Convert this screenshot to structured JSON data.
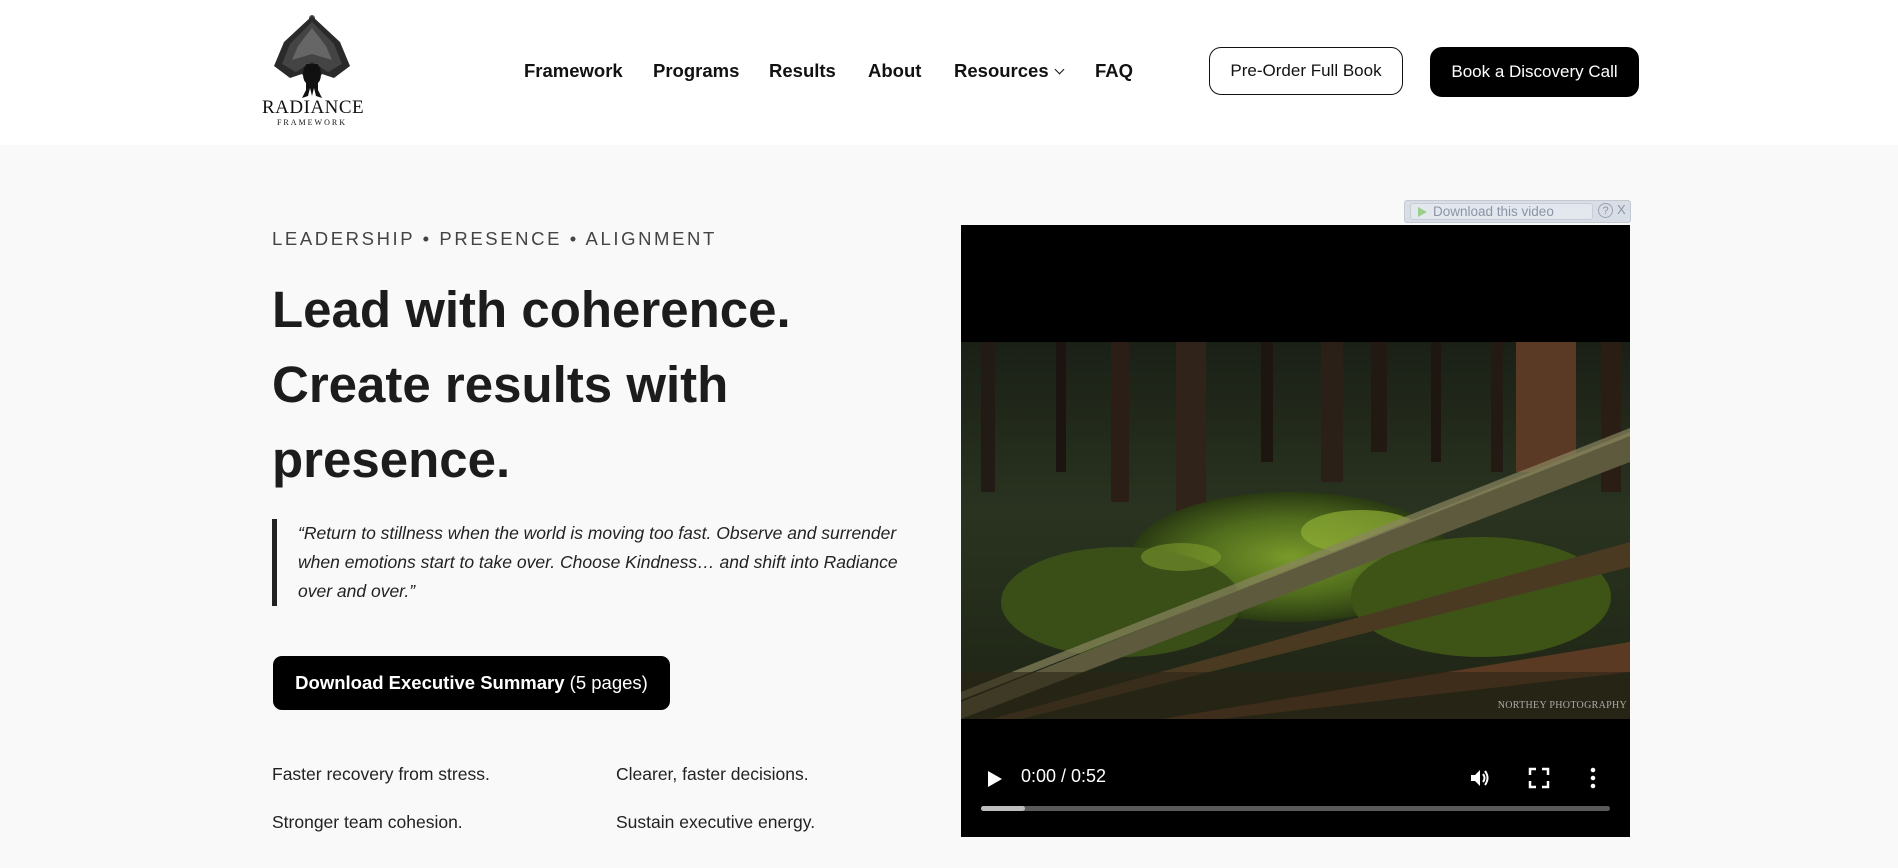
{
  "brand": {
    "name": "RADIANCE",
    "sub": "FRAMEWORK"
  },
  "nav": {
    "items": [
      {
        "label": "Framework"
      },
      {
        "label": "Programs"
      },
      {
        "label": "Results"
      },
      {
        "label": "About"
      },
      {
        "label": "Resources"
      },
      {
        "label": "FAQ"
      }
    ],
    "preorder_label": "Pre-Order Full Book",
    "discovery_label": "Book a Discovery Call"
  },
  "hero": {
    "eyebrow": "LEADERSHIP • PRESENCE • ALIGNMENT",
    "headline_1": "Lead with coherence.",
    "headline_2": "Create results with",
    "headline_3": "presence.",
    "quote": "“Return to stillness when the world is moving too fast. Observe and surrender when emotions start to take over. Choose Kindness… and shift into Radiance over and over.”",
    "download_bold": "Download Executive Summary",
    "download_rest": " (5 pages)",
    "benefits": [
      "Faster recovery from stress.",
      "Clearer, faster decisions.",
      "Stronger team cohesion.",
      "Sustain executive energy."
    ]
  },
  "video": {
    "download_bar_label": "Download this video",
    "help_label": "?",
    "close_label": "X",
    "time": "0:00 / 0:52",
    "progress_fraction": 0.07,
    "watermark": "NORTHEY PHOTOGRAPHY"
  }
}
